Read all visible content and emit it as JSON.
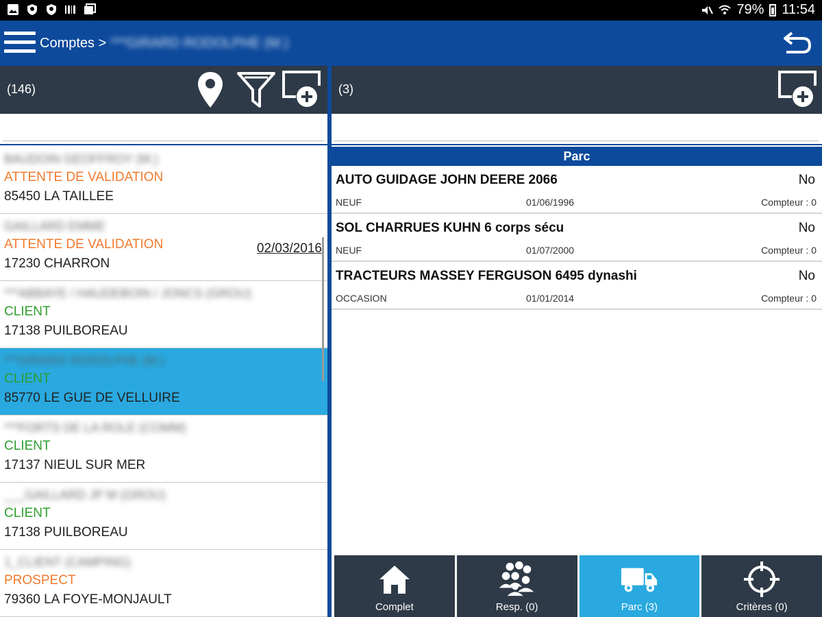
{
  "status_bar": {
    "battery": "79%",
    "time": "11:54"
  },
  "app_bar": {
    "breadcrumb_root": "Comptes >",
    "breadcrumb_current": "***GIRARD RODOLPHE (M.)"
  },
  "left_panel": {
    "count": "(146)",
    "search": {
      "value": "",
      "placeholder": ""
    },
    "accounts": [
      {
        "name": "BAUDOIN GEOFFROY (M.)",
        "status": "ATTENTE DE VALIDATION",
        "status_color": "#f07a2e",
        "city": "85450 LA TAILLEE",
        "date": ""
      },
      {
        "name": "GAILLARD EMME",
        "status": "ATTENTE DE VALIDATION",
        "status_color": "#f07a2e",
        "city": "17230 CHARRON",
        "date": "02/03/2016"
      },
      {
        "name": "***ABBAYE / HAUDEBOIN / JONCS (GROU)",
        "status": "CLIENT",
        "status_color": "#2e9e2e",
        "city": "17138 PUILBOREAU",
        "date": ""
      },
      {
        "name": "***GIRARD RODOLPHE (M.)",
        "status": "CLIENT",
        "status_color": "#2e9e2e",
        "city": "85770 LE GUE DE VELLUIRE",
        "date": "",
        "selected": true
      },
      {
        "name": "***FORTS DE LA ROLE (COMM)",
        "status": "CLIENT",
        "status_color": "#2e9e2e",
        "city": "17137 NIEUL SUR MER",
        "date": ""
      },
      {
        "name": "___GAILLARD JP M (GROU)",
        "status": "CLIENT",
        "status_color": "#2e9e2e",
        "city": "17138 PUILBOREAU",
        "date": ""
      },
      {
        "name": "1_CLIENT (CAMPING)",
        "status": "PROSPECT",
        "status_color": "#f07a2e",
        "city": "79360 LA FOYE-MONJAULT",
        "date": ""
      }
    ]
  },
  "right_panel": {
    "count": "(3)",
    "search": {
      "value": "",
      "placeholder": ""
    },
    "section_title": "Parc",
    "items": [
      {
        "title": "AUTO GUIDAGE JOHN DEERE 2066",
        "flag": "No",
        "state": "NEUF",
        "date": "01/06/1996",
        "counter": "Compteur : 0"
      },
      {
        "title": "SOL CHARRUES KUHN 6 corps sécu",
        "flag": "No",
        "state": "NEUF",
        "date": "01/07/2000",
        "counter": "Compteur : 0"
      },
      {
        "title": "TRACTEURS MASSEY FERGUSON 6495 dynashi",
        "flag": "No",
        "state": "OCCASION",
        "date": "01/01/2014",
        "counter": "Compteur : 0"
      }
    ]
  },
  "bottom_nav": {
    "tabs": [
      {
        "label": "Complet",
        "icon": "home-icon"
      },
      {
        "label": "Resp. (0)",
        "icon": "people-icon"
      },
      {
        "label": "Parc (3)",
        "icon": "truck-icon",
        "active": true
      },
      {
        "label": "Critères (0)",
        "icon": "target-icon"
      }
    ]
  },
  "colors": {
    "app_bar": "#0d4a9c",
    "panel_header": "#2e3a47",
    "selected": "#29a9df",
    "status_pending": "#f07a2e",
    "status_client": "#2e9e2e"
  }
}
